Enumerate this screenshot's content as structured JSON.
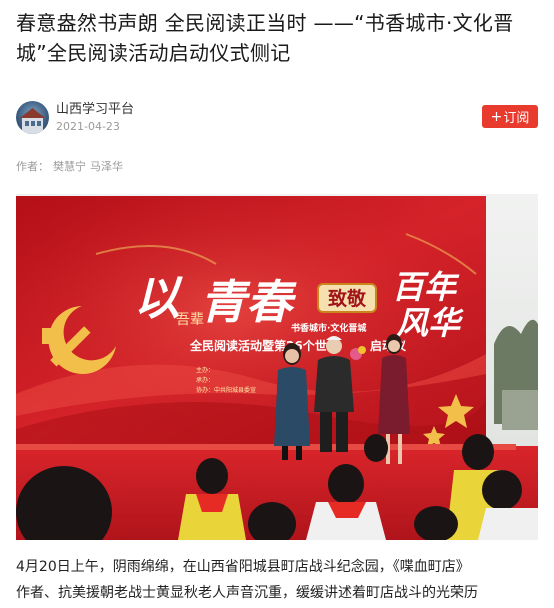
{
  "article": {
    "title": "春意盎然书声朗 全民阅读正当时 ——“书香城市·文化晋城”全民阅读活动启动仪式侧记",
    "publisher": {
      "name": "山西学习平台",
      "date": "2021-04-23"
    },
    "follow_button": {
      "plus": "+",
      "label": "订阅"
    },
    "byline": {
      "label": "作者：",
      "authors": [
        "樊慧宁",
        "马泽华"
      ]
    },
    "banner": {
      "text_from": "以",
      "text_youth": "青春",
      "text_salute": "致敬",
      "text_century": "百年",
      "text_glory": "风华",
      "text_small": "吾辈",
      "text_subtitle": "书香城市·文化晋城",
      "text_main": "全民阅读活动暨第26个世界",
      "text_main_tail": "启动仪",
      "text_host": "主办：",
      "text_co": "协办：中共阳城县委宣",
      "text_undertake": "承办："
    },
    "body": {
      "line1_prefix": "4月20日",
      "line1_rest": "上午，阴雨绵绵，在山西省阳城县町店战斗纪念园，《喋血町店》",
      "line2": "作者、抗美援朝老战士黄显秋老人声音沉重，缓缓讲述着町店战斗的光荣历"
    },
    "colors": {
      "accent": "#e83b2e",
      "banner_red": "#c8141c"
    },
    "icons": {
      "avatar": "avatar-image",
      "plus": "plus-icon"
    }
  }
}
